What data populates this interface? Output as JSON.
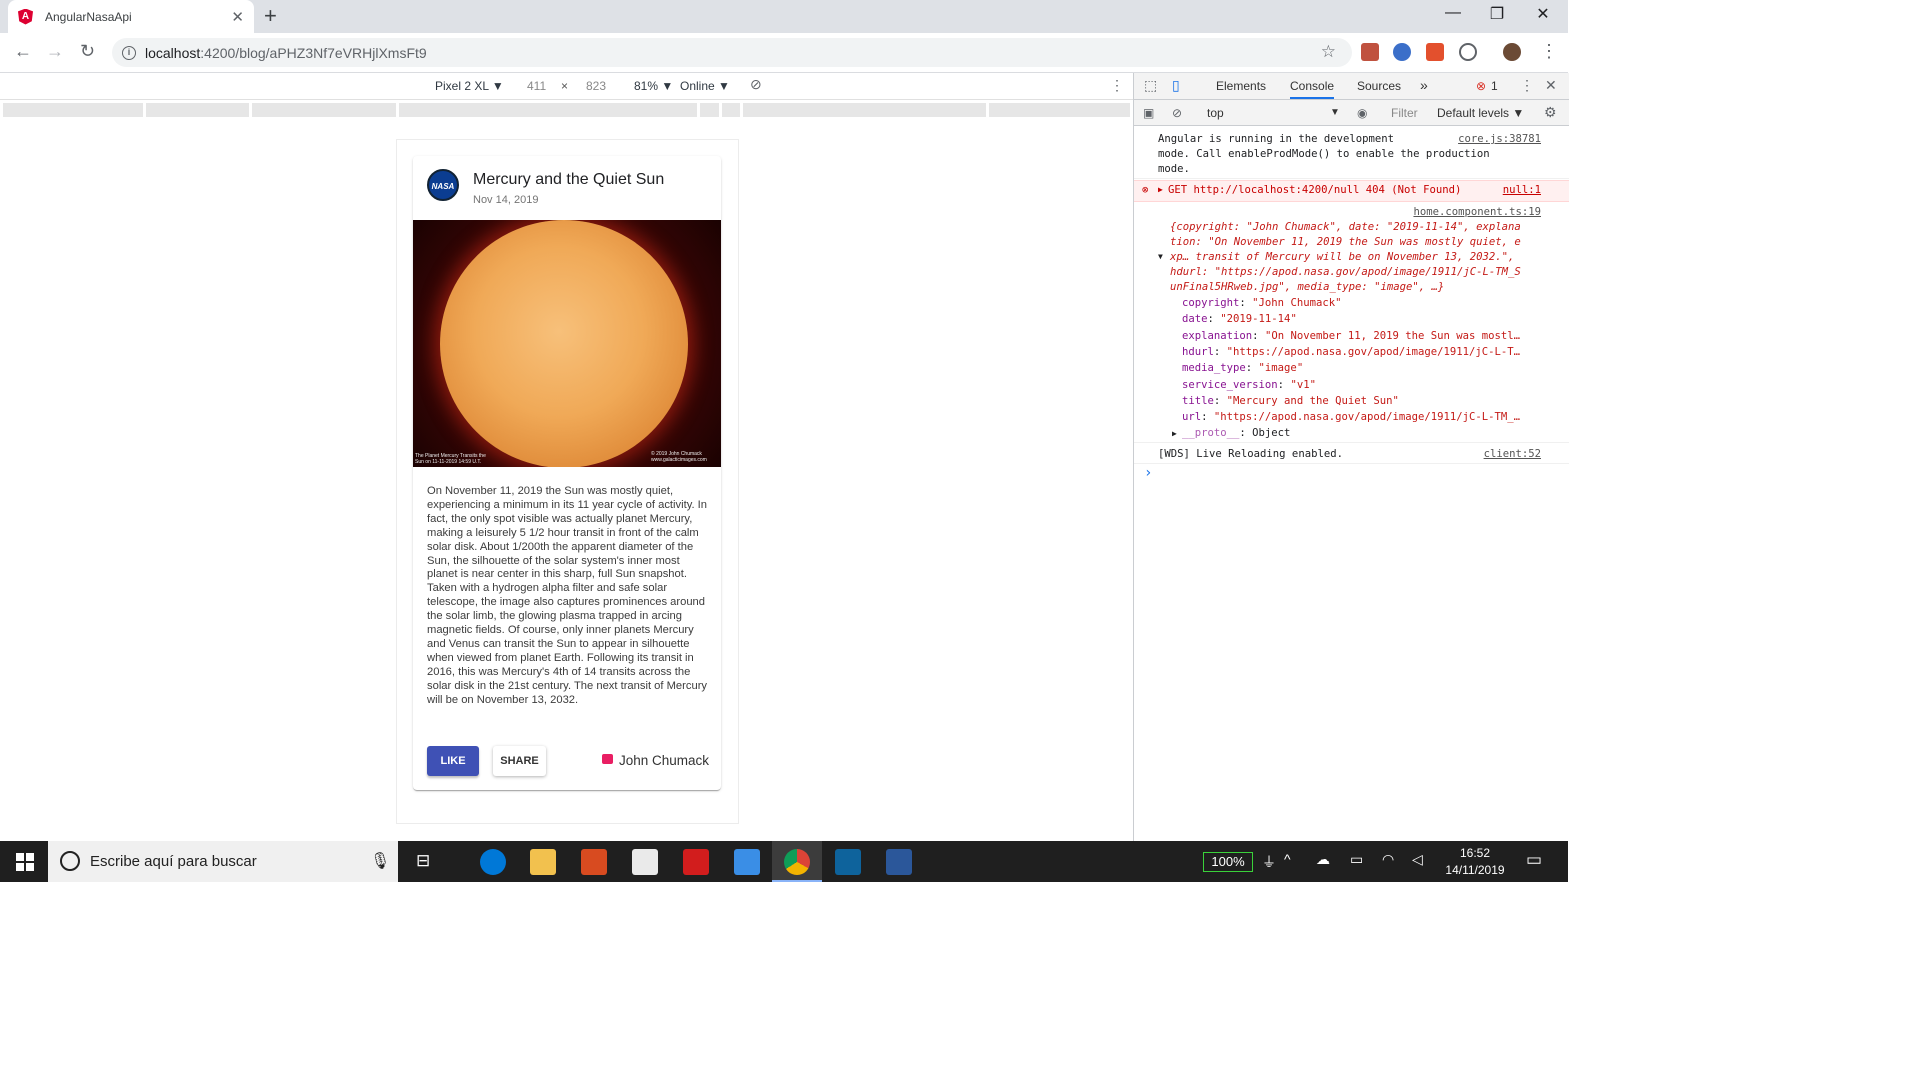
{
  "browser": {
    "tab_title": "AngularNasaApi",
    "tab_icon": "A",
    "close_tab": "✕",
    "new_tab": "+",
    "url_host": "localhost",
    "url_path": ":4200/blog/aPHZ3Nf7eVRHjlXmsFt9",
    "window_minimize": "—",
    "window_restore": "❐",
    "window_close": "✕"
  },
  "device_toolbar": {
    "device": "Pixel 2 XL ▼",
    "width": "411",
    "times": "×",
    "height": "823",
    "zoom": "81% ▼",
    "network": "Online ▼"
  },
  "card": {
    "avatar_label": "NASA",
    "title": "Mercury and the Quiet Sun",
    "date": "Nov 14, 2019",
    "image_caption_left": "The Planet Mercury Transits the Sun on 11-11-2019 14:59 U.T.",
    "image_caption_right": "© 2019 John Chumack www.galacticimages.com",
    "explanation": "On November 11, 2019 the Sun was mostly quiet, experiencing a minimum in its 11 year cycle of activity. In fact, the only spot visible was actually planet Mercury, making a leisurely 5 1/2 hour transit in front of the calm solar disk. About 1/200th the apparent diameter of the Sun, the silhouette of the solar system's inner most planet is near center in this sharp, full Sun snapshot. Taken with a hydrogen alpha filter and safe solar telescope, the image also captures prominences around the solar limb, the glowing plasma trapped in arcing magnetic fields. Of course, only inner planets Mercury and Venus can transit the Sun to appear in silhouette when viewed from planet Earth. Following its transit in 2016, this was Mercury's 4th of 14 transits across the solar disk in the 21st century. The next transit of Mercury will be on November 13, 2032.",
    "like_label": "LIKE",
    "share_label": "SHARE",
    "copyright": "John Chumack"
  },
  "devtools": {
    "tabs": [
      "Elements",
      "Console",
      "Sources",
      "»"
    ],
    "error_count": "1",
    "context": "top",
    "context_arrow": "▼",
    "filter_placeholder": "Filter",
    "levels": "Default levels ▼",
    "console": {
      "msg1_l1": "Angular is running in the development",
      "msg1_l2": "mode. Call enableProdMode() to enable the production",
      "msg1_l3": "mode.",
      "msg1_src": "core.js:38781",
      "err_text": "GET http://localhost:4200/null 404 (Not Found)",
      "err_src": "null:1",
      "obj_src": "home.component.ts:19",
      "obj_l1": "{copyright: \"John Chumack\", date: \"2019-11-14\", explana",
      "obj_l2": "tion: \"On November 11, 2019 the Sun was mostly quiet, e",
      "obj_l3": "xp… transit of Mercury will be on November 13, 2032.\",",
      "obj_l4": "hdurl: \"https://apod.nasa.gov/apod/image/1911/jC-L-TM_S",
      "obj_l5": "unFinal5HRweb.jpg\", media_type: \"image\", …}",
      "props": [
        {
          "k": "copyright",
          "v": "\"John Chumack\""
        },
        {
          "k": "date",
          "v": "\"2019-11-14\""
        },
        {
          "k": "explanation",
          "v": "\"On November 11, 2019 the Sun was mostl…"
        },
        {
          "k": "hdurl",
          "v": "\"https://apod.nasa.gov/apod/image/1911/jC-L-T…"
        },
        {
          "k": "media_type",
          "v": "\"image\""
        },
        {
          "k": "service_version",
          "v": "\"v1\""
        },
        {
          "k": "title",
          "v": "\"Mercury and the Quiet Sun\""
        },
        {
          "k": "url",
          "v": "\"https://apod.nasa.gov/apod/image/1911/jC-L-TM_…"
        }
      ],
      "proto_key": "__proto__",
      "proto_val": ": Object",
      "wds": "[WDS] Live Reloading enabled.",
      "wds_src": "client:52",
      "prompt": "›"
    }
  },
  "taskbar": {
    "search_placeholder": "Escribe aquí para buscar",
    "battery": "100%",
    "time": "16:52",
    "date": "14/11/2019"
  },
  "colors": {
    "accent": "#3f51b5",
    "error": "#c80000",
    "angular": "#dd0031"
  }
}
